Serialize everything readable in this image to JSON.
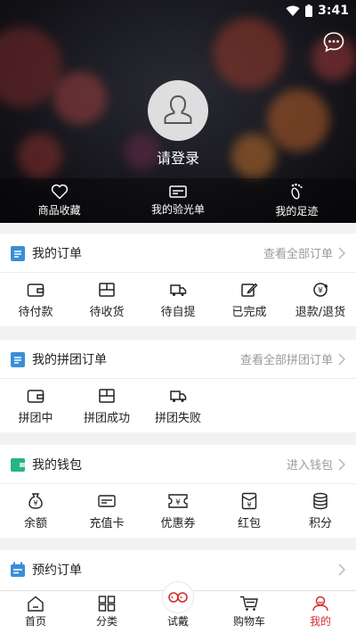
{
  "status": {
    "time": "3:41"
  },
  "header": {
    "login_text": "请登录"
  },
  "quick_links": [
    {
      "label": "商品收藏",
      "icon": "heart-icon"
    },
    {
      "label": "我的验光单",
      "icon": "card-icon"
    },
    {
      "label": "我的足迹",
      "icon": "footprint-icon"
    }
  ],
  "orders": {
    "title": "我的订单",
    "more": "查看全部订单",
    "items": [
      {
        "label": "待付款",
        "icon": "wallet-icon"
      },
      {
        "label": "待收货",
        "icon": "box-icon"
      },
      {
        "label": "待自提",
        "icon": "truck-icon"
      },
      {
        "label": "已完成",
        "icon": "edit-icon"
      },
      {
        "label": "退款/退货",
        "icon": "refund-icon"
      }
    ]
  },
  "group_orders": {
    "title": "我的拼团订单",
    "more": "查看全部拼团订单",
    "items": [
      {
        "label": "拼团中",
        "icon": "wallet-icon"
      },
      {
        "label": "拼团成功",
        "icon": "box-icon"
      },
      {
        "label": "拼团失败",
        "icon": "truck-icon"
      }
    ]
  },
  "wallet": {
    "title": "我的钱包",
    "more": "进入钱包",
    "items": [
      {
        "label": "余额",
        "icon": "money-bag-icon"
      },
      {
        "label": "充值卡",
        "icon": "card-icon"
      },
      {
        "label": "优惠券",
        "icon": "coupon-icon"
      },
      {
        "label": "红包",
        "icon": "red-packet-icon"
      },
      {
        "label": "积分",
        "icon": "coins-icon"
      }
    ]
  },
  "appointment": {
    "title": "预约订单"
  },
  "bottom_nav": [
    {
      "label": "首页",
      "icon": "home-icon"
    },
    {
      "label": "分类",
      "icon": "grid-icon"
    },
    {
      "label": "试戴",
      "icon": "glasses-icon"
    },
    {
      "label": "购物车",
      "icon": "cart-icon"
    },
    {
      "label": "我的",
      "icon": "profile-icon",
      "active": true
    }
  ],
  "colors": {
    "accent": "#d32f2f",
    "section_icon_blue": "#3a8ed8",
    "section_icon_green": "#26b38a"
  }
}
